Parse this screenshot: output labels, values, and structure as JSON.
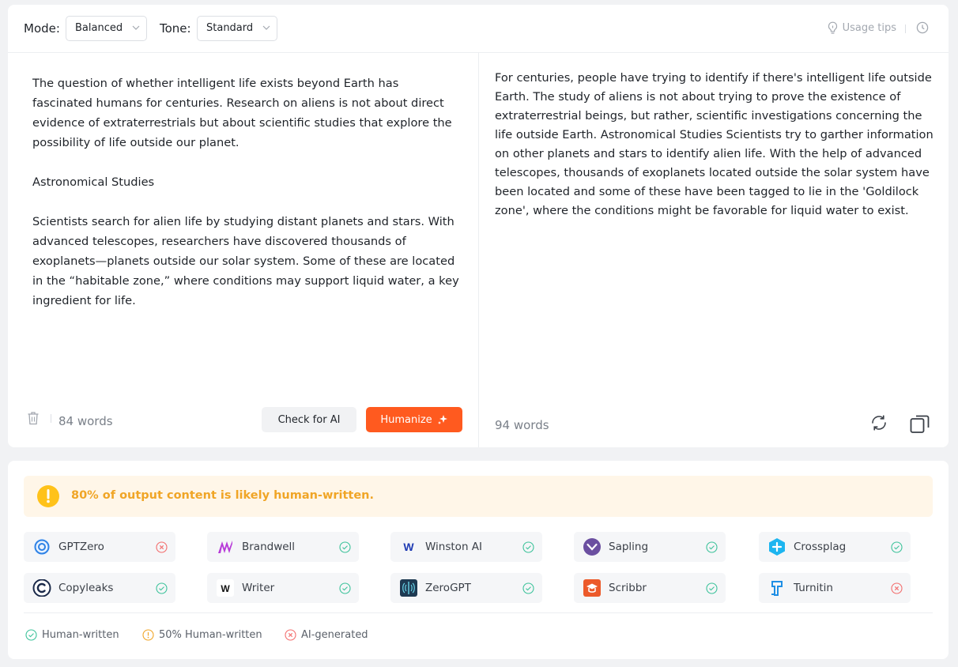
{
  "colors": {
    "accent": "#ff5a1f",
    "pass": "#3cc29a",
    "fail": "#f36d6d",
    "warn": "#f0a526"
  },
  "toolbar": {
    "mode_label": "Mode:",
    "mode_value": "Balanced",
    "tone_label": "Tone:",
    "tone_value": "Standard",
    "usage_tips": "Usage tips",
    "usage_icon": "lightbulb-icon",
    "history_icon": "clock-icon"
  },
  "input": {
    "paragraphs": [
      "The question of whether intelligent life exists beyond Earth has fascinated humans for centuries. Research on aliens is not about direct evidence of extraterrestrials but about scientific studies that explore the possibility of life outside our planet.",
      "Astronomical Studies",
      "Scientists search for alien life by studying distant planets and stars. With advanced telescopes, researchers have discovered thousands of exoplanets—planets outside our solar system. Some of these are located in the “habitable zone,” where conditions may support liquid water, a key ingredient for life."
    ],
    "word_count": "84 words",
    "check_button": "Check for AI",
    "humanize_button": "Humanize",
    "trash_icon": "trash-icon",
    "sparkle_icon": "sparkle-icon"
  },
  "output": {
    "text": "For centuries, people have trying to identify if there's intelligent life outside Earth. The study of aliens is not about trying to prove the existence of extraterrestrial beings, but rather, scientific investigations concerning the life outside Earth. Astronomical Studies Scientists try to garther information on other planets and stars to identify alien life. With the help of advanced telescopes, thousands of exoplanets located outside the solar system have been located and some of these have been tagged to lie in the 'Goldilock zone', where the conditions might be favorable for liquid water to exist.",
    "word_count": "94 words",
    "regenerate_icon": "refresh-icon",
    "copy_icon": "copy-icon"
  },
  "result": {
    "banner": "80% of output content is likely human-written.",
    "banner_icon": "warning-icon",
    "detectors": [
      {
        "name": "GPTZero",
        "status": "fail",
        "logo": "gptzero-logo"
      },
      {
        "name": "Brandwell",
        "status": "pass",
        "logo": "brandwell-logo"
      },
      {
        "name": "Winston AI",
        "status": "pass",
        "logo": "winston-logo"
      },
      {
        "name": "Sapling",
        "status": "pass",
        "logo": "sapling-logo"
      },
      {
        "name": "Crossplag",
        "status": "pass",
        "logo": "crossplag-logo"
      },
      {
        "name": "Copyleaks",
        "status": "pass",
        "logo": "copyleaks-logo"
      },
      {
        "name": "Writer",
        "status": "pass",
        "logo": "writer-logo"
      },
      {
        "name": "ZeroGPT",
        "status": "pass",
        "logo": "zerogpt-logo"
      },
      {
        "name": "Scribbr",
        "status": "pass",
        "logo": "scribbr-logo"
      },
      {
        "name": "Turnitin",
        "status": "fail",
        "logo": "turnitin-logo"
      }
    ],
    "legend": {
      "human": "Human-written",
      "half": "50% Human-written",
      "ai": "AI-generated"
    }
  }
}
